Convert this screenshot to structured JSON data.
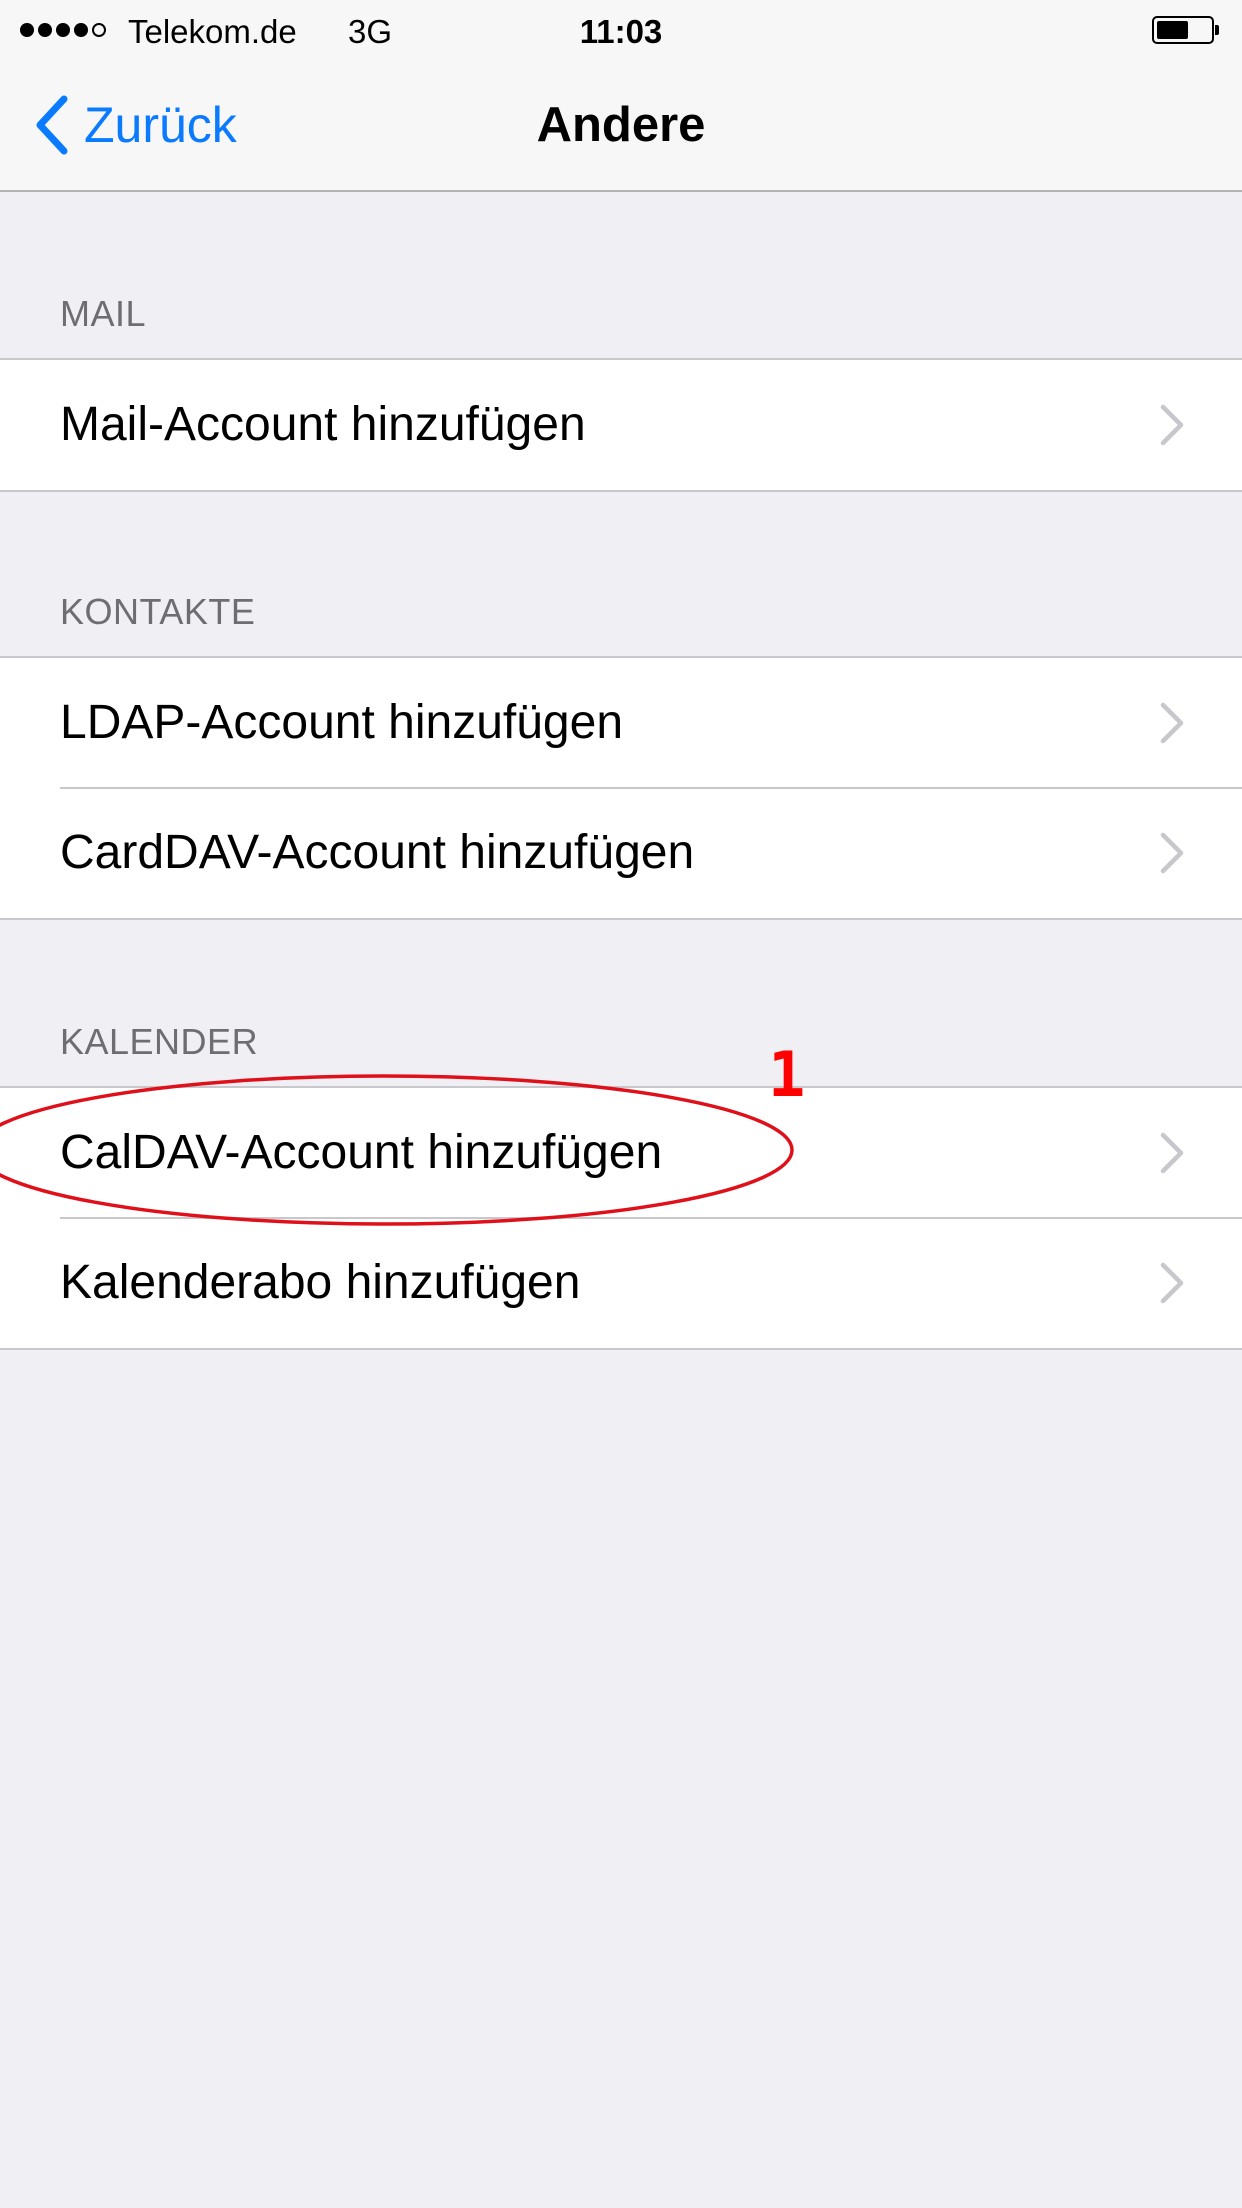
{
  "status_bar": {
    "carrier": "Telekom.de",
    "network": "3G",
    "time": "11:03",
    "signal_strength": 4,
    "signal_max": 5,
    "battery_level": 0.6
  },
  "nav": {
    "back_label": "Zurück",
    "title": "Andere",
    "accent_color": "#0a7aff"
  },
  "sections": [
    {
      "header": "MAIL",
      "rows": [
        {
          "label": "Mail-Account hinzufügen"
        }
      ]
    },
    {
      "header": "KONTAKTE",
      "rows": [
        {
          "label": "LDAP-Account hinzufügen"
        },
        {
          "label": "CardDAV-Account hinzufügen"
        }
      ]
    },
    {
      "header": "KALENDER",
      "rows": [
        {
          "label": "CalDAV-Account hinzufügen"
        },
        {
          "label": "Kalenderabo hinzufügen"
        }
      ]
    }
  ],
  "annotation": {
    "number": "1",
    "color": "#ff0000"
  },
  "icons": {
    "back": "chevron-left-icon",
    "row_disclosure": "chevron-right-icon",
    "battery": "battery-icon"
  }
}
